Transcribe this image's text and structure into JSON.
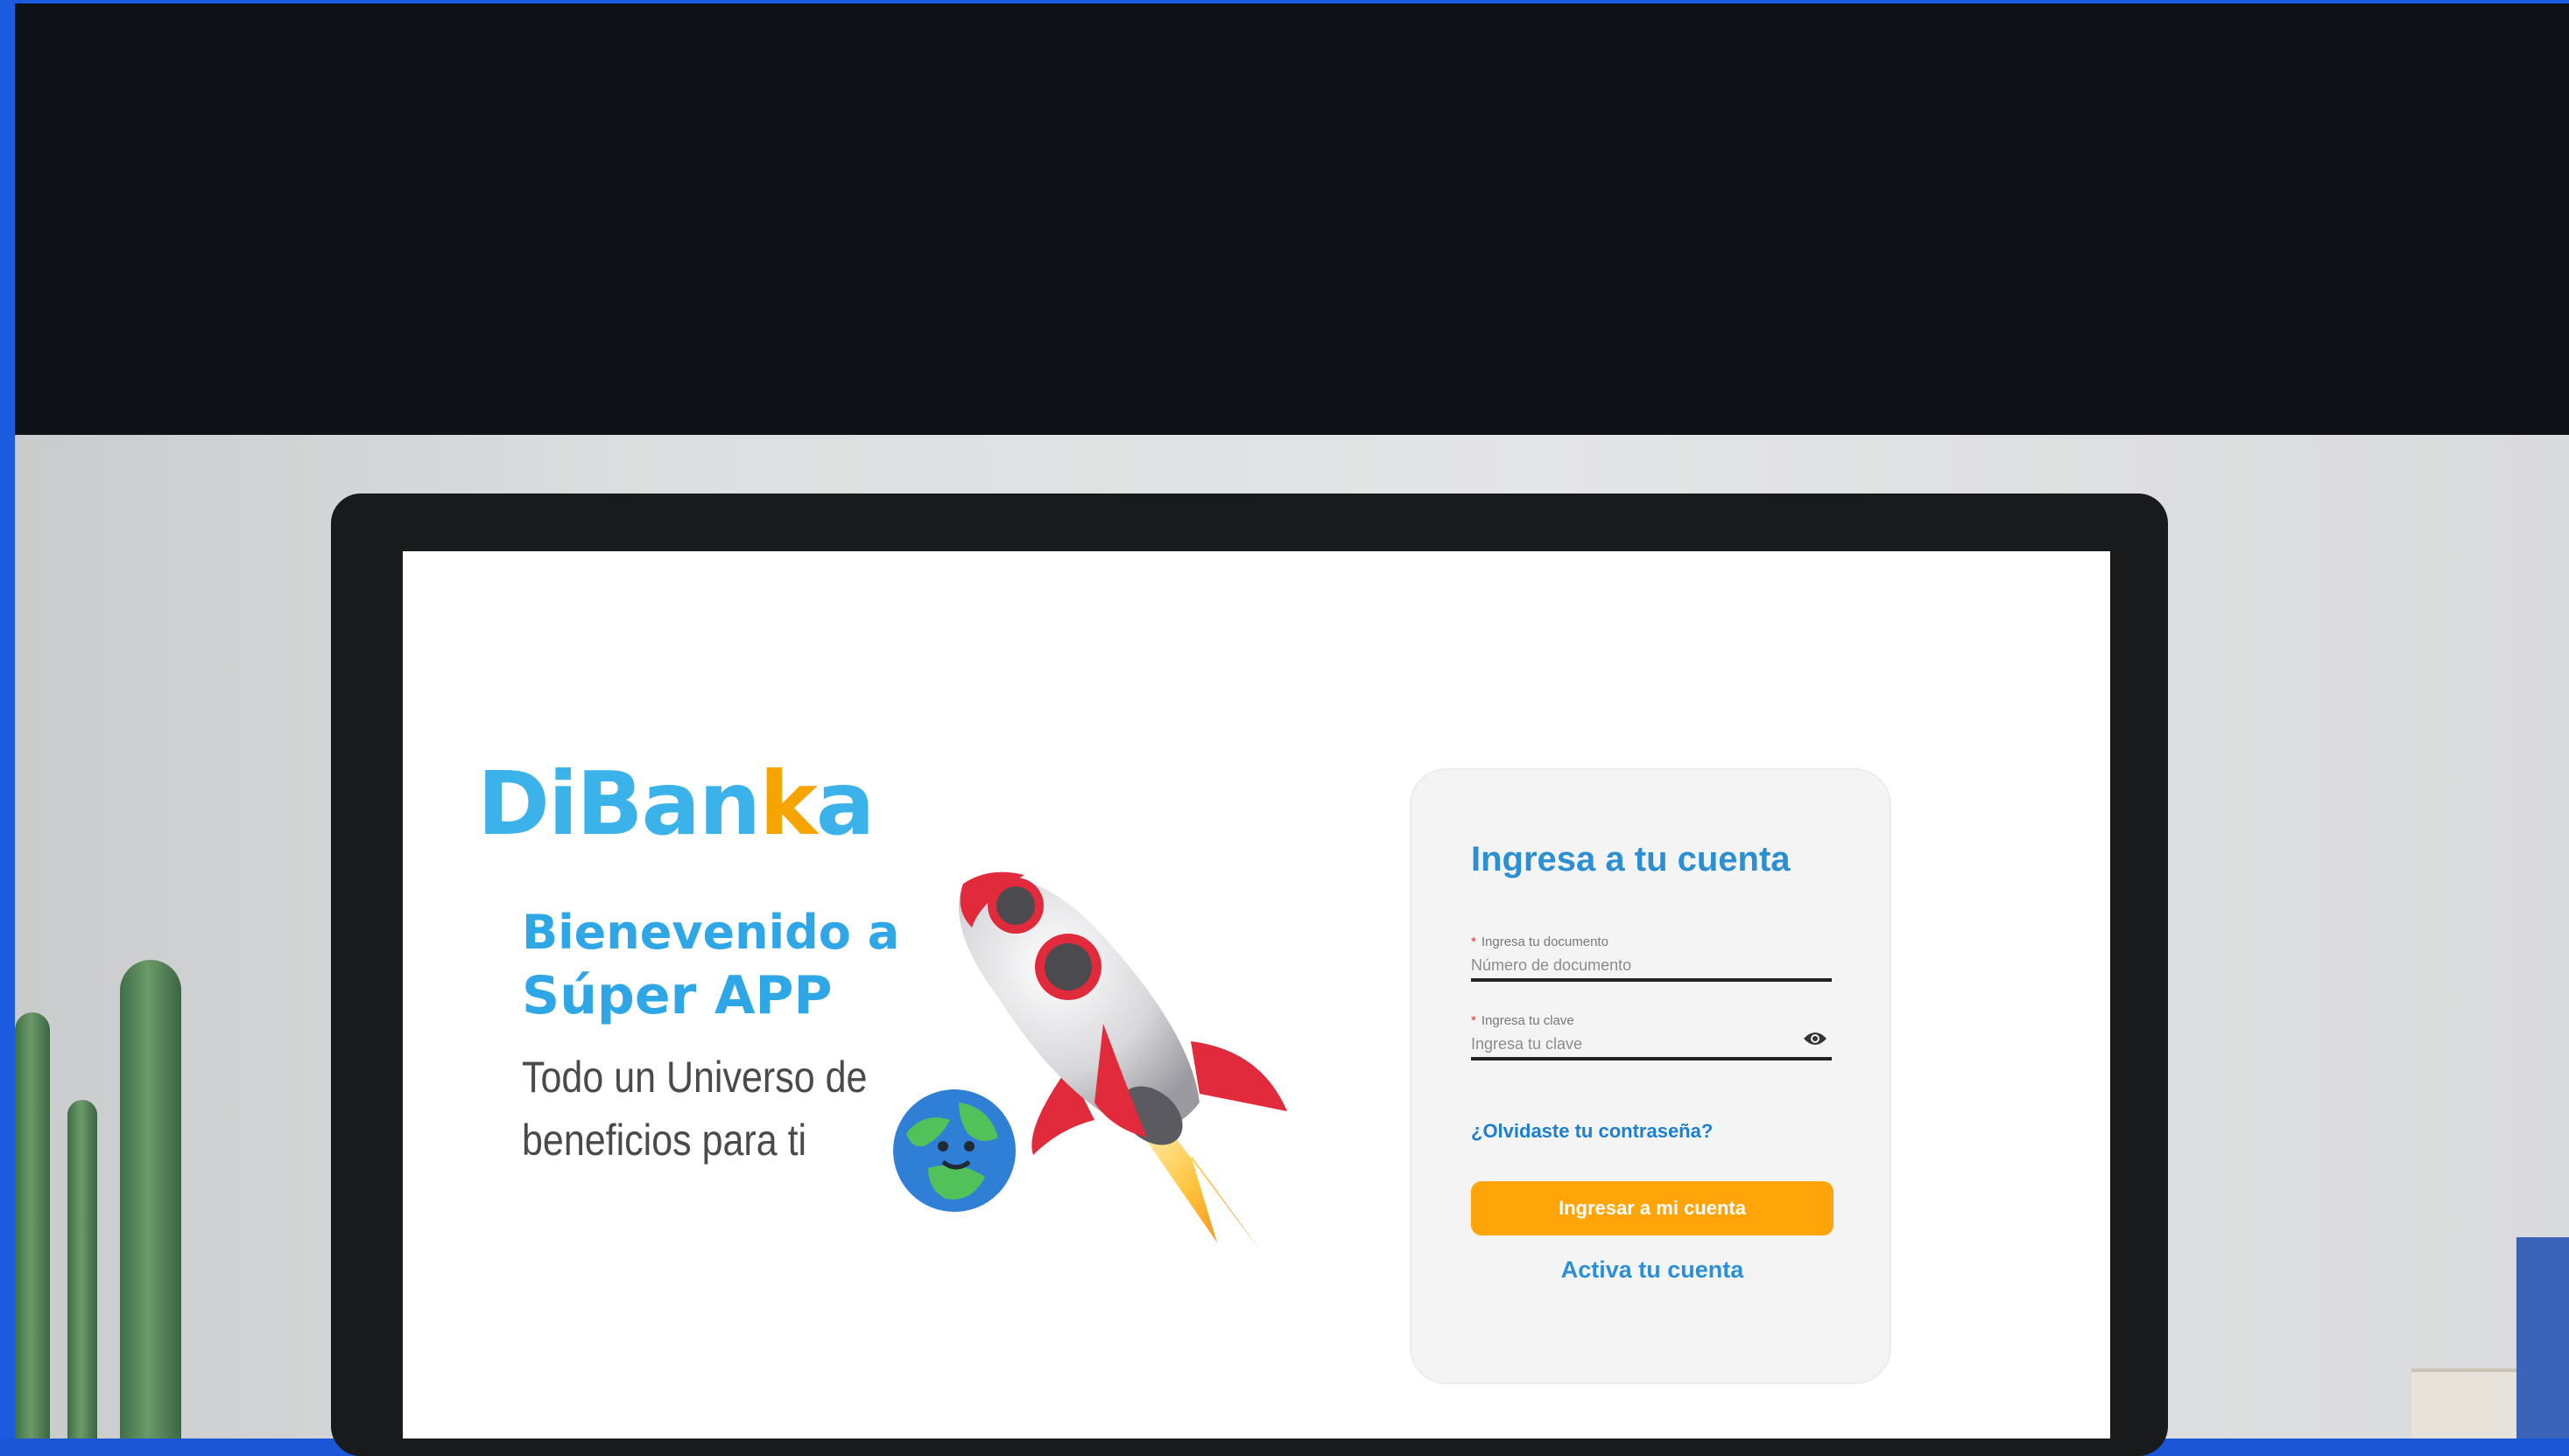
{
  "brand": {
    "logo_main": "DiBan",
    "logo_accent": "k",
    "logo_end": "a",
    "primary_color": "#3bb2ea",
    "accent_color": "#f5a400"
  },
  "hero": {
    "welcome_line1": "Bienevenido a",
    "welcome_line2": "Súper APP",
    "tagline_line1": "Todo un Universo de",
    "tagline_line2": "beneficios para ti"
  },
  "login": {
    "title": "Ingresa a tu cuenta",
    "document_label": "Ingresa tu documento",
    "document_placeholder": "Número de documento",
    "password_label": "Ingresa tu clave",
    "password_placeholder": "Ingresa tu clave",
    "required_mark": "*",
    "forgot_link": "¿Olvidaste tu contraseña?",
    "submit_label": "Ingresar a mi cuenta",
    "activate_link": "Activa tu cuenta",
    "button_color": "#ffa50a"
  },
  "icons": {
    "password_toggle": "eye-icon",
    "rocket": "rocket-illustration",
    "planet": "planet-illustration"
  }
}
